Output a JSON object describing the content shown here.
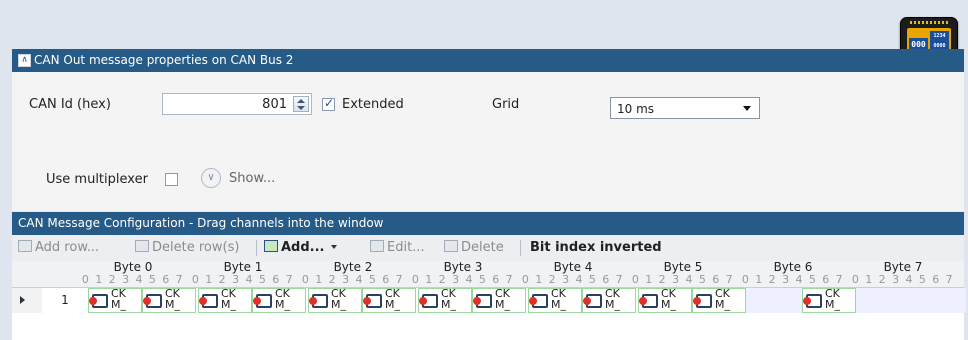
{
  "props_panel": {
    "title": "CAN Out message properties on CAN Bus 2",
    "can_id_label": "CAN Id (hex)",
    "can_id_value": "801",
    "extended_label": "Extended",
    "extended_checked": true,
    "grid_label": "Grid",
    "grid_value": "10 ms",
    "multiplexer_label": "Use multiplexer",
    "multiplexer_checked": false,
    "show_label": "Show..."
  },
  "config_panel": {
    "title": "CAN Message Configuration - Drag channels into the window",
    "toolbar": {
      "add_row": "Add row...",
      "delete_row": "Delete row(s)",
      "add": "Add...",
      "edit": "Edit...",
      "delete": "Delete",
      "bit_index": "Bit index inverted"
    },
    "bit_digits": "0 1 2 3 4 5 6 7",
    "bytes": [
      "Byte 0",
      "Byte 1",
      "Byte 2",
      "Byte 3",
      "Byte 4",
      "Byte 5",
      "Byte 6",
      "Byte 7"
    ],
    "row": {
      "number": "1",
      "signal_text_line1": "CK",
      "signal_text_line2": "M_"
    }
  },
  "colors": {
    "header_bg": "#265b87",
    "signal_border": "#9fd69f",
    "empty_cell": "#eff0ff"
  },
  "icons": [
    "device-display-icon",
    "collapse-icon",
    "spin-up-icon",
    "spin-down-icon",
    "chevron-down-icon",
    "signal-icon"
  ]
}
